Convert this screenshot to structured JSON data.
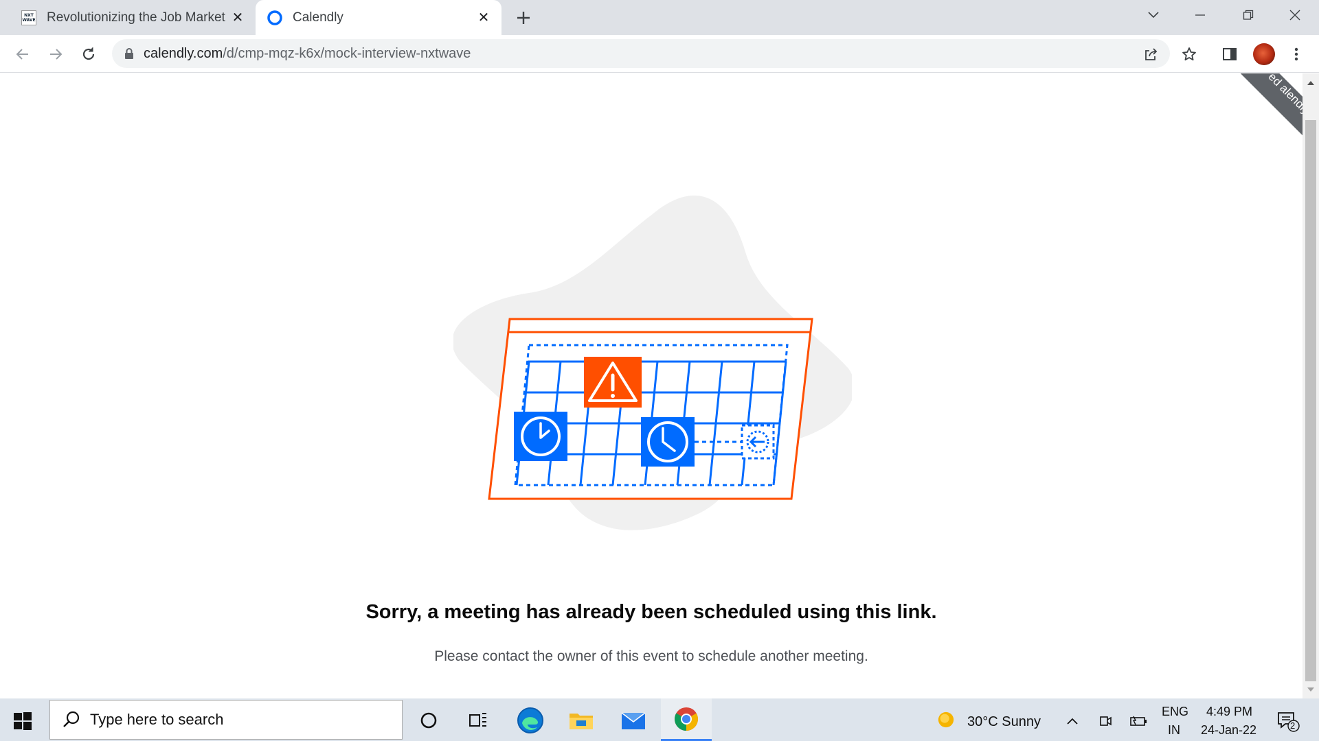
{
  "browser": {
    "tabs": [
      {
        "title": "Revolutionizing the Job Market |",
        "favicon": "nxtwave-logo"
      },
      {
        "title": "Calendly",
        "favicon": "calendly-logo"
      }
    ],
    "new_tab_icon": "plus-icon",
    "url_host": "calendly.com",
    "url_path": "/d/cmp-mqz-k6x/mock-interview-nxtwave"
  },
  "page": {
    "ribbon_text": "ed alendly",
    "heading": "Sorry, a meeting has already been scheduled using this link.",
    "subheading": "Please contact the owner of this event to schedule another meeting.",
    "colors": {
      "accent_orange": "#ff4f00",
      "accent_blue": "#006bff",
      "blob": "#f0f0f0"
    }
  },
  "taskbar": {
    "search_placeholder": "Type here to search",
    "weather": "30°C  Sunny",
    "lang_top": "ENG",
    "lang_bottom": "IN",
    "time": "4:49 PM",
    "date": "24-Jan-22",
    "notifications": "2"
  }
}
